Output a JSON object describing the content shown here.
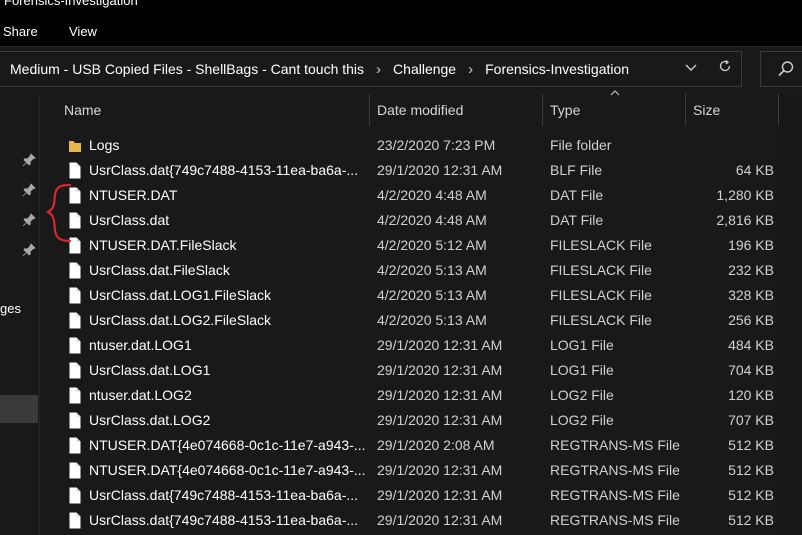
{
  "window": {
    "title": "Forensics-Investigation"
  },
  "ribbon": {
    "tabs": [
      "Share",
      "View"
    ]
  },
  "address": {
    "crumbs": [
      "Medium - USB Copied Files - ShellBags - Cant touch this",
      "Challenge",
      "Forensics-Investigation"
    ]
  },
  "nav": {
    "partial_label": "ges"
  },
  "columns": {
    "name": "Name",
    "date": "Date modified",
    "type": "Type",
    "size": "Size"
  },
  "files": [
    {
      "name": "Logs",
      "date": "23/2/2020 7:23 PM",
      "type": "File folder",
      "size": "",
      "icon": "folder-icon"
    },
    {
      "name": "UsrClass.dat{749c7488-4153-11ea-ba6a-...",
      "date": "29/1/2020 12:31 AM",
      "type": "BLF File",
      "size": "64 KB",
      "icon": "file-icon"
    },
    {
      "name": "NTUSER.DAT",
      "date": "4/2/2020 4:48 AM",
      "type": "DAT File",
      "size": "1,280 KB",
      "icon": "file-icon"
    },
    {
      "name": "UsrClass.dat",
      "date": "4/2/2020 4:48 AM",
      "type": "DAT File",
      "size": "2,816 KB",
      "icon": "file-icon"
    },
    {
      "name": "NTUSER.DAT.FileSlack",
      "date": "4/2/2020 5:12 AM",
      "type": "FILESLACK File",
      "size": "196 KB",
      "icon": "file-icon"
    },
    {
      "name": "UsrClass.dat.FileSlack",
      "date": "4/2/2020 5:13 AM",
      "type": "FILESLACK File",
      "size": "232 KB",
      "icon": "file-icon"
    },
    {
      "name": "UsrClass.dat.LOG1.FileSlack",
      "date": "4/2/2020 5:13 AM",
      "type": "FILESLACK File",
      "size": "328 KB",
      "icon": "file-icon"
    },
    {
      "name": "UsrClass.dat.LOG2.FileSlack",
      "date": "4/2/2020 5:13 AM",
      "type": "FILESLACK File",
      "size": "256 KB",
      "icon": "file-icon"
    },
    {
      "name": "ntuser.dat.LOG1",
      "date": "29/1/2020 12:31 AM",
      "type": "LOG1 File",
      "size": "484 KB",
      "icon": "file-icon"
    },
    {
      "name": "UsrClass.dat.LOG1",
      "date": "29/1/2020 12:31 AM",
      "type": "LOG1 File",
      "size": "704 KB",
      "icon": "file-icon"
    },
    {
      "name": "ntuser.dat.LOG2",
      "date": "29/1/2020 12:31 AM",
      "type": "LOG2 File",
      "size": "120 KB",
      "icon": "file-icon"
    },
    {
      "name": "UsrClass.dat.LOG2",
      "date": "29/1/2020 12:31 AM",
      "type": "LOG2 File",
      "size": "707 KB",
      "icon": "file-icon"
    },
    {
      "name": "NTUSER.DAT{4e074668-0c1c-11e7-a943-...",
      "date": "29/1/2020 2:08 AM",
      "type": "REGTRANS-MS File",
      "size": "512 KB",
      "icon": "file-icon"
    },
    {
      "name": "NTUSER.DAT{4e074668-0c1c-11e7-a943-...",
      "date": "29/1/2020 12:31 AM",
      "type": "REGTRANS-MS File",
      "size": "512 KB",
      "icon": "file-icon"
    },
    {
      "name": "UsrClass.dat{749c7488-4153-11ea-ba6a-...",
      "date": "29/1/2020 12:31 AM",
      "type": "REGTRANS-MS File",
      "size": "512 KB",
      "icon": "file-icon"
    },
    {
      "name": "UsrClass.dat{749c7488-4153-11ea-ba6a-...",
      "date": "29/1/2020 12:31 AM",
      "type": "REGTRANS-MS File",
      "size": "512 KB",
      "icon": "file-icon"
    }
  ],
  "annotation": {
    "color": "#d8272d"
  },
  "colors": {
    "background": "#191919",
    "ribbon": "#000000",
    "folder": "#e8b64a",
    "text": "#ffffff"
  }
}
